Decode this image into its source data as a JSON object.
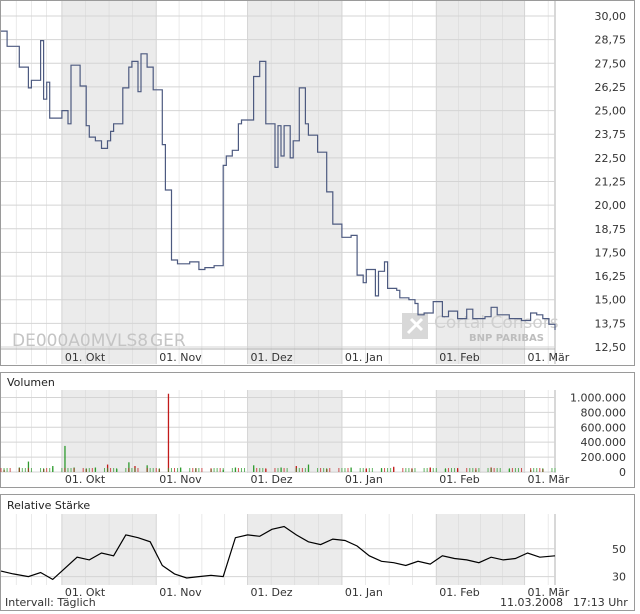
{
  "colors": {
    "price_line": "#4d5a80",
    "rsi_line": "#000000",
    "volume_up": "#2e9b2e",
    "volume_down": "#c21a1a",
    "shade": "#ebebeb",
    "grid": "#d4d4d4",
    "frame": "#9a9a9a"
  },
  "watermark": {
    "isin": "DE000A0MVLS8",
    "exchange": "GER",
    "brand": "Cortal Consors",
    "brand_sub": "BNP PARIBAS"
  },
  "footer": {
    "interval": "Intervall: Täglich",
    "date": "11.03.2008",
    "time": "17:13 Uhr"
  },
  "chart_data": [
    {
      "type": "line",
      "panel": "price",
      "title": "",
      "x_range": [
        "2007-09-11",
        "2008-03-11"
      ],
      "ylim": [
        12.5,
        30.0
      ],
      "x_ticks": [
        {
          "label": "01. Okt",
          "date": "2007-10-01"
        },
        {
          "label": "01. Nov",
          "date": "2007-11-01"
        },
        {
          "label": "01. Dez",
          "date": "2007-12-01"
        },
        {
          "label": "01. Jan",
          "date": "2008-01-01"
        },
        {
          "label": "01. Feb",
          "date": "2008-02-01"
        },
        {
          "label": "01. Mär",
          "date": "2008-03-01"
        }
      ],
      "y_ticks": [
        "30,00",
        "28,75",
        "27,50",
        "26,25",
        "25,00",
        "23,75",
        "22,50",
        "21,25",
        "20,00",
        "18,75",
        "17,50",
        "16,25",
        "15,00",
        "13,75",
        "12,50"
      ],
      "grid": true,
      "shaded_months": [
        "Okt",
        "Dez",
        "Feb"
      ],
      "series": [
        {
          "x": [
            "2007-09-11",
            "2007-09-13",
            "2007-09-17",
            "2007-09-20",
            "2007-09-21",
            "2007-09-24",
            "2007-09-25",
            "2007-09-26",
            "2007-09-27",
            "2007-10-01",
            "2007-10-03",
            "2007-10-04",
            "2007-10-07",
            "2007-10-09",
            "2007-10-10",
            "2007-10-12",
            "2007-10-14",
            "2007-10-16",
            "2007-10-17",
            "2007-10-18",
            "2007-10-21",
            "2007-10-23",
            "2007-10-24",
            "2007-10-26",
            "2007-10-27",
            "2007-10-29",
            "2007-10-31",
            "2007-11-03",
            "2007-11-04",
            "2007-11-06",
            "2007-11-08",
            "2007-11-12",
            "2007-11-15",
            "2007-11-17",
            "2007-11-20",
            "2007-11-23",
            "2007-11-24",
            "2007-11-26",
            "2007-11-28",
            "2007-11-29",
            "2007-12-03",
            "2007-12-05",
            "2007-12-07",
            "2007-12-10",
            "2007-12-11",
            "2007-12-12",
            "2007-12-13",
            "2007-12-15",
            "2007-12-16",
            "2007-12-18",
            "2007-12-20",
            "2007-12-21",
            "2007-12-24",
            "2007-12-27",
            "2007-12-29",
            "2008-01-01",
            "2008-01-04",
            "2008-01-06",
            "2008-01-08",
            "2008-01-09",
            "2008-01-12",
            "2008-01-13",
            "2008-01-15",
            "2008-01-16",
            "2008-01-19",
            "2008-01-20",
            "2008-01-23",
            "2008-01-25",
            "2008-01-26",
            "2008-01-28",
            "2008-01-30",
            "2008-01-31",
            "2008-02-03",
            "2008-02-05",
            "2008-02-08",
            "2008-02-11",
            "2008-02-13",
            "2008-02-17",
            "2008-02-19",
            "2008-02-21",
            "2008-02-25",
            "2008-02-29",
            "2008-03-03",
            "2008-03-05",
            "2008-03-07",
            "2008-03-09",
            "2008-03-11"
          ],
          "values": [
            29.2,
            28.4,
            27.3,
            26.2,
            26.6,
            28.7,
            25.6,
            26.5,
            24.6,
            25.0,
            24.3,
            27.4,
            26.3,
            24.2,
            23.6,
            23.4,
            23.0,
            23.4,
            23.9,
            24.3,
            26.2,
            27.3,
            27.6,
            26.0,
            28.0,
            27.3,
            26.1,
            23.2,
            20.8,
            17.1,
            16.9,
            17.0,
            16.6,
            16.7,
            16.8,
            22.1,
            22.6,
            22.9,
            24.3,
            24.5,
            26.8,
            27.6,
            24.3,
            22.0,
            24.2,
            22.6,
            24.2,
            22.5,
            23.4,
            26.2,
            24.3,
            23.7,
            22.8,
            20.7,
            19.0,
            18.3,
            18.4,
            16.3,
            15.9,
            16.6,
            15.2,
            16.5,
            17.0,
            15.6,
            15.5,
            15.1,
            15.0,
            14.8,
            14.2,
            14.3,
            14.3,
            14.9,
            14.1,
            14.4,
            14.0,
            14.5,
            14.0,
            14.1,
            14.6,
            14.2,
            14.0,
            13.9,
            14.3,
            14.2,
            14.0,
            13.7,
            13.4
          ]
        }
      ]
    },
    {
      "type": "bar",
      "panel": "volume",
      "title": "Volumen",
      "ylim": [
        0,
        1100000
      ],
      "y_ticks": [
        "1.000.000",
        "800.000",
        "600.000",
        "400.000",
        "200.000",
        "0"
      ],
      "grid": true,
      "series": [
        {
          "x": [
            "2007-09-12",
            "2007-09-17",
            "2007-09-20",
            "2007-09-25",
            "2007-09-28",
            "2007-10-02",
            "2007-10-05",
            "2007-10-09",
            "2007-10-12",
            "2007-10-16",
            "2007-10-19",
            "2007-10-23",
            "2007-10-25",
            "2007-10-29",
            "2007-11-02",
            "2007-11-05",
            "2007-11-09",
            "2007-11-14",
            "2007-11-19",
            "2007-11-23",
            "2007-11-27",
            "2007-12-03",
            "2007-12-07",
            "2007-12-12",
            "2007-12-17",
            "2007-12-21",
            "2007-12-27",
            "2008-01-04",
            "2008-01-09",
            "2008-01-14",
            "2008-01-18",
            "2008-01-24",
            "2008-01-30",
            "2008-02-04",
            "2008-02-08",
            "2008-02-14",
            "2008-02-19",
            "2008-02-25",
            "2008-03-03",
            "2008-03-07"
          ],
          "values": [
            30000,
            60000,
            140000,
            40000,
            80000,
            350000,
            60000,
            40000,
            60000,
            100000,
            40000,
            130000,
            80000,
            90000,
            40000,
            1050000,
            60000,
            50000,
            40000,
            30000,
            60000,
            90000,
            40000,
            60000,
            80000,
            100000,
            40000,
            60000,
            40000,
            50000,
            70000,
            40000,
            60000,
            40000,
            50000,
            30000,
            60000,
            40000,
            30000,
            40000
          ],
          "direction": [
            "down",
            "up",
            "up",
            "down",
            "up",
            "up",
            "up",
            "down",
            "up",
            "down",
            "up",
            "up",
            "down",
            "up",
            "down",
            "down",
            "up",
            "down",
            "up",
            "up",
            "up",
            "up",
            "down",
            "up",
            "down",
            "up",
            "down",
            "up",
            "down",
            "up",
            "down",
            "up",
            "down",
            "up",
            "down",
            "up",
            "down",
            "up",
            "up",
            "down"
          ]
        }
      ]
    },
    {
      "type": "line",
      "panel": "rsi",
      "title": "Relative Stärke",
      "ylim": [
        24,
        75
      ],
      "y_ticks": [
        "50",
        "30"
      ],
      "grid": true,
      "series": [
        {
          "x": [
            "2007-09-11",
            "2007-09-15",
            "2007-09-20",
            "2007-09-24",
            "2007-09-28",
            "2007-10-02",
            "2007-10-06",
            "2007-10-10",
            "2007-10-14",
            "2007-10-18",
            "2007-10-22",
            "2007-10-26",
            "2007-10-30",
            "2007-11-03",
            "2007-11-07",
            "2007-11-11",
            "2007-11-15",
            "2007-11-19",
            "2007-11-23",
            "2007-11-27",
            "2007-12-01",
            "2007-12-05",
            "2007-12-09",
            "2007-12-13",
            "2007-12-17",
            "2007-12-21",
            "2007-12-25",
            "2007-12-29",
            "2008-01-02",
            "2008-01-06",
            "2008-01-10",
            "2008-01-14",
            "2008-01-18",
            "2008-01-22",
            "2008-01-26",
            "2008-01-30",
            "2008-02-03",
            "2008-02-07",
            "2008-02-11",
            "2008-02-15",
            "2008-02-19",
            "2008-02-23",
            "2008-02-27",
            "2008-03-02",
            "2008-03-06",
            "2008-03-11"
          ],
          "values": [
            34,
            32,
            30,
            33,
            28,
            36,
            44,
            42,
            47,
            45,
            60,
            58,
            55,
            38,
            32,
            29,
            30,
            31,
            30,
            58,
            60,
            59,
            64,
            66,
            60,
            55,
            53,
            57,
            56,
            52,
            45,
            41,
            40,
            38,
            41,
            39,
            45,
            43,
            42,
            40,
            44,
            42,
            43,
            47,
            44,
            45
          ]
        }
      ]
    }
  ]
}
